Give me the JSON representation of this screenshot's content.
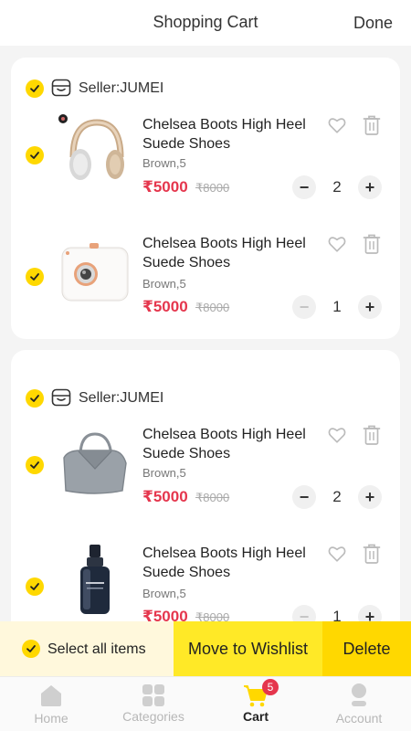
{
  "header": {
    "title": "Shopping Cart",
    "done_label": "Done"
  },
  "colors": {
    "accent": "#ffd800",
    "price": "#e5364d"
  },
  "sellers": [
    {
      "name": "Seller:JUMEI",
      "items": [
        {
          "name": "Chelsea Boots High Heel Suede Shoes",
          "variant": "Brown,5",
          "price": "₹5000",
          "old_price": "₹8000",
          "qty": "2",
          "image": "headphones"
        },
        {
          "name": "Chelsea Boots High Heel Suede Shoes",
          "variant": "Brown,5",
          "price": "₹5000",
          "old_price": "₹8000",
          "qty": "1",
          "image": "instant-camera"
        }
      ]
    },
    {
      "name": "Seller:JUMEI",
      "items": [
        {
          "name": "Chelsea Boots High Heel Suede Shoes",
          "variant": "Brown,5",
          "price": "₹5000",
          "old_price": "₹8000",
          "qty": "2",
          "image": "handbag"
        },
        {
          "name": "Chelsea Boots High Heel Suede Shoes",
          "variant": "Brown,5",
          "price": "₹5000",
          "old_price": "₹8000",
          "qty": "1",
          "image": "serum-bottle"
        }
      ]
    }
  ],
  "action_bar": {
    "select_all_label": "Select all items",
    "wishlist_label": "Move to Wishlist",
    "delete_label": "Delete"
  },
  "tabbar": {
    "home": "Home",
    "categories": "Categories",
    "cart": "Cart",
    "cart_badge": "5",
    "account": "Account"
  }
}
